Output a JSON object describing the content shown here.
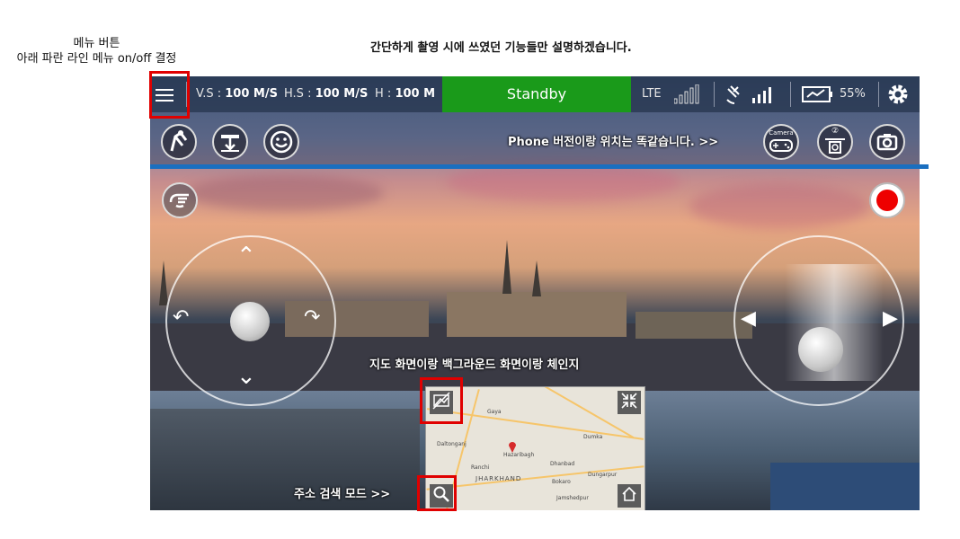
{
  "annotations": {
    "menu_note_line1": "메뉴 버튼",
    "menu_note_line2": "아래 파란 라인 메뉴 on/off 결정",
    "top_note": "간단하게 촬영 시에 쓰였던 기능들만 설명하겠습니다.",
    "phone_note": "Phone 버전이랑 위치는 똑같습니다. >>",
    "map_note": "지도 화면이랑 백그라운드 화면이랑 체인지",
    "search_note": "주소 검색 모드 >>"
  },
  "topbar": {
    "vs_label": "V.S :",
    "vs_value": "100 M/S",
    "hs_label": "H.S :",
    "hs_value": "100 M/S",
    "h_label": "H :",
    "h_value": "100 M",
    "status": "Standby",
    "network": "LTE",
    "battery": "55%",
    "status_color": "#1a9a1a"
  },
  "row2": {
    "camera_label": "Camera",
    "drone_number": "②"
  },
  "map": {
    "labels": [
      "Gaya",
      "Hazaribagh",
      "Ranchi",
      "JHARKHAND",
      "Dhanbad",
      "Bokaro",
      "Dumka",
      "Dungarpur",
      "Jamshedpur",
      "Daltonganj"
    ],
    "state": "JHARKHAND"
  },
  "icons": [
    "menu-icon",
    "signal-icon",
    "satellite-icon",
    "battery-icon",
    "gear-icon",
    "takeoff-icon",
    "landing-icon",
    "smile-icon",
    "gamepad-icon",
    "drone-camera-icon",
    "camera-icon",
    "gesture-icon",
    "record-icon",
    "map-swap-icon",
    "shrink-icon",
    "search-icon",
    "home-icon"
  ]
}
